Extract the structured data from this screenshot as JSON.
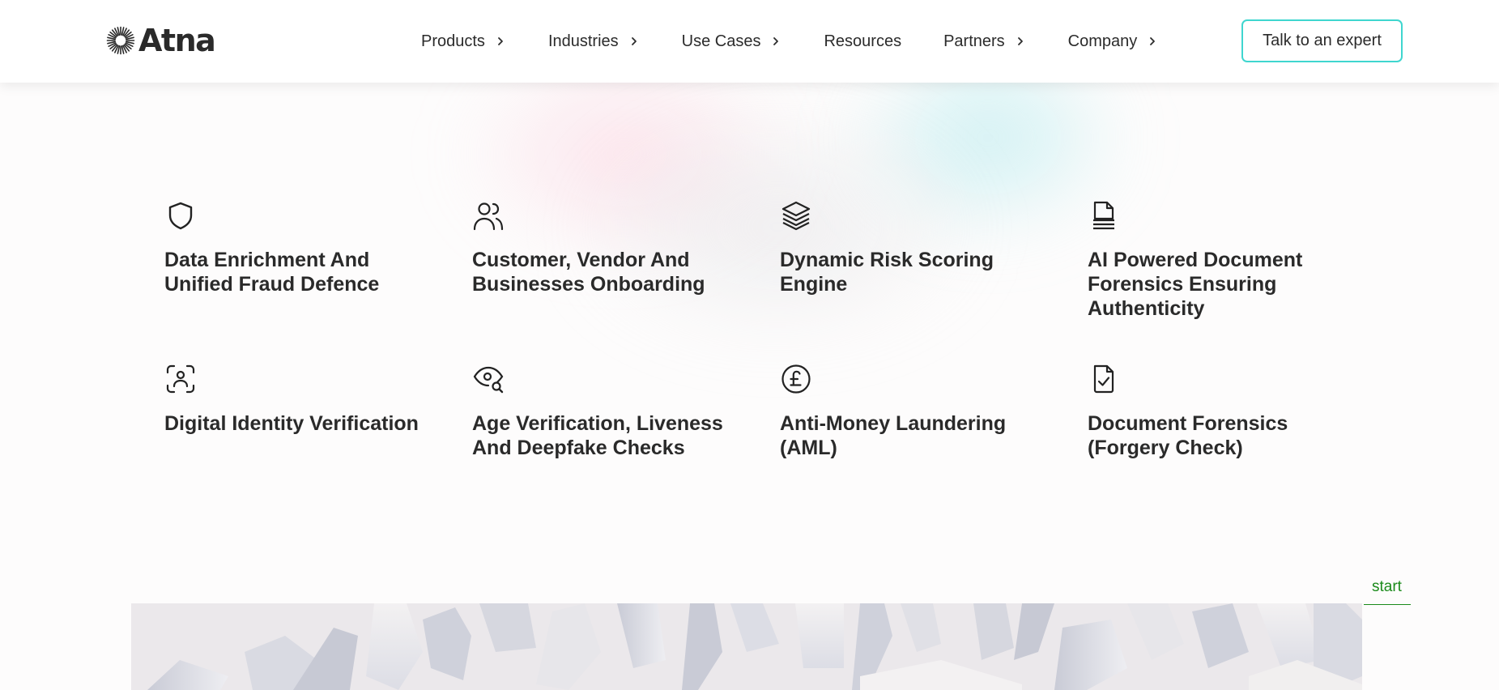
{
  "header": {
    "logo_text": "Atna",
    "nav": [
      {
        "label": "Products",
        "has_chevron": true
      },
      {
        "label": "Industries",
        "has_chevron": true
      },
      {
        "label": "Use Cases",
        "has_chevron": true
      },
      {
        "label": "Resources",
        "has_chevron": false
      },
      {
        "label": "Partners",
        "has_chevron": true
      },
      {
        "label": "Company",
        "has_chevron": true
      }
    ],
    "cta_label": "Talk to an expert"
  },
  "features": [
    {
      "icon": "shield-icon",
      "title": "Data Enrichment And Unified Fraud Defence"
    },
    {
      "icon": "users-icon",
      "title": "Customer, Vendor And Businesses Onboarding"
    },
    {
      "icon": "layers-icon",
      "title": "Dynamic Risk Scoring Engine"
    },
    {
      "icon": "document-lines-icon",
      "title": "AI Powered Document Forensics Ensuring Authenticity"
    },
    {
      "icon": "face-scan-icon",
      "title": "Digital Identity Verification"
    },
    {
      "icon": "eye-search-icon",
      "title": "Age Verification, Liveness And Deepfake Checks"
    },
    {
      "icon": "pound-coin-icon",
      "title": "Anti-Money Laundering (AML)"
    },
    {
      "icon": "document-check-icon",
      "title": "Document Forensics (Forgery Check)"
    }
  ],
  "marker": {
    "label": "start"
  },
  "colors": {
    "accent": "#3fd6cf",
    "marker": "#1a8a1a",
    "text": "#2a2a2a"
  }
}
